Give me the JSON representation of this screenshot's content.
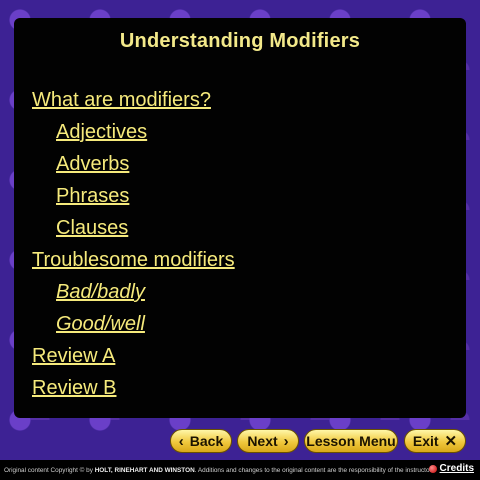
{
  "title": "Understanding Modifiers",
  "menu": [
    {
      "label": "What are modifiers?"
    },
    {
      "label": "Adjectives"
    },
    {
      "label": "Adverbs"
    },
    {
      "label": "Phrases"
    },
    {
      "label": "Clauses"
    },
    {
      "label": "Troublesome modifiers"
    },
    {
      "label": "Bad/badly"
    },
    {
      "label": "Good/well"
    },
    {
      "label": "Review A"
    },
    {
      "label": "Review B"
    }
  ],
  "nav": {
    "back": "Back",
    "next": "Next",
    "lesson_menu": "Lesson Menu",
    "exit": "Exit"
  },
  "footer": {
    "copyright_prefix": "Original content Copyright © by",
    "publisher": "HOLT, RINEHART AND WINSTON",
    "copyright_suffix": ". Additions and changes to the original content are the responsibility of the instructor.",
    "credits": "Credits"
  },
  "colors": {
    "link": "#f6ea7c",
    "title": "#f3e98a",
    "panel": "#020202",
    "button": "#f0c83d"
  }
}
